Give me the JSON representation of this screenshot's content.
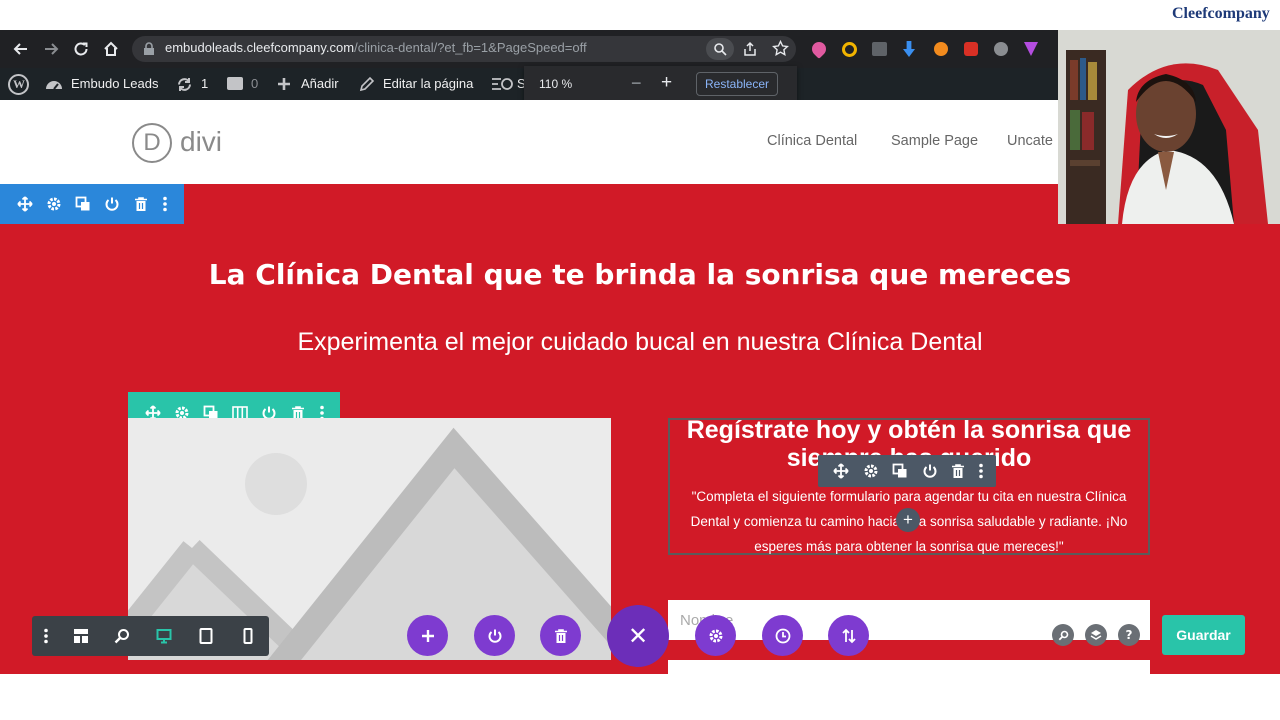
{
  "brand": "Cleefcompany",
  "browser": {
    "url_domain": "embudoleads.cleefcompany.com",
    "url_path": "/clinica-dental/?et_fb=1&PageSpeed=off"
  },
  "zoom_popup": {
    "level": "110 %",
    "minus": "−",
    "plus": "+",
    "reset_label": "Restablecer"
  },
  "admin_bar": {
    "site_name": "Embudo Leads",
    "updates_count": "1",
    "comments_count": "0",
    "add_label": "Añadir",
    "edit_label": "Editar la página",
    "truncated": "S"
  },
  "site": {
    "logo_text": "divi",
    "logo_letter": "D",
    "nav": [
      "Clínica Dental",
      "Sample Page",
      "Uncate"
    ]
  },
  "hero": {
    "title": "La Clínica Dental que te brinda la sonrisa que mereces",
    "subtitle": "Experimenta el mejor cuidado bucal en nuestra Clínica Dental"
  },
  "register": {
    "title": "Regístrate hoy y obtén la sonrisa que siempre has querido",
    "body": "\"Completa el siguiente formulario para agendar tu cita en nuestra Clínica Dental y comienza tu camino hacia una sonrisa saludable y radiante. ¡No esperes más para obtener la sonrisa que mereces!\""
  },
  "form": {
    "name_placeholder": "Nombre"
  },
  "builder": {
    "save_label": "Guardar",
    "add_module_symbol": "+",
    "close_symbol": "✕"
  },
  "colors": {
    "hero_red": "#d11a27",
    "section_blue": "#2b87da",
    "row_green": "#29c4a9",
    "module_gray": "#4c5866",
    "builder_purple": "#7e3bd0",
    "close_purple": "#6c2eb9"
  },
  "icons": {
    "move": "move-icon",
    "settings": "gear-icon",
    "duplicate": "duplicate-icon",
    "columns": "columns-icon",
    "power": "power-icon",
    "trash": "trash-icon",
    "more": "more-vertical-icon"
  }
}
